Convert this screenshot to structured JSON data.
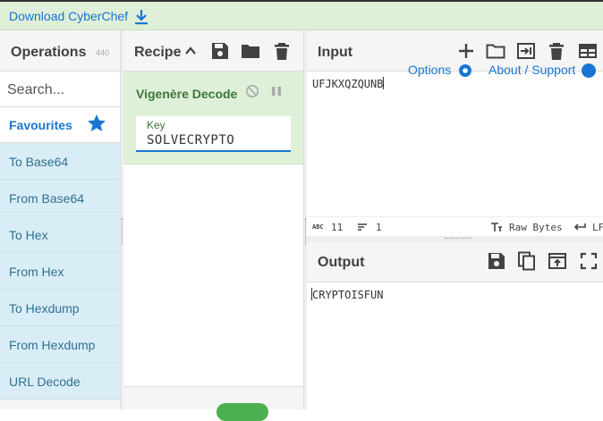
{
  "banner": {
    "download_label": "Download CyberChef",
    "download_icon": "download-icon"
  },
  "operations": {
    "title": "Operations",
    "count": "440",
    "search_placeholder": "Search...",
    "favourites_label": "Favourites",
    "items": [
      "To Base64",
      "From Base64",
      "To Hex",
      "From Hex",
      "To Hexdump",
      "From Hexdump",
      "URL Decode"
    ]
  },
  "recipe": {
    "title": "Recipe",
    "operation": {
      "name": "Vigenère Decode",
      "arg_label": "Key",
      "arg_value": "SOLVECRYPTO"
    }
  },
  "input": {
    "title": "Input",
    "overlay_options": "Options",
    "overlay_about": "About / Support",
    "text": "UFJKXQZQUNB",
    "status": {
      "length": "11",
      "lines": "1",
      "encoding": "Raw Bytes",
      "eol": "LF"
    }
  },
  "output": {
    "title": "Output",
    "text": "CRYPTOISFUN"
  },
  "colors": {
    "accent": "#1976d2",
    "recipe_green_bg": "#dff0d8",
    "recipe_green_text": "#3c763d",
    "operation_bg": "#d9edf7",
    "operation_text": "#31708f"
  }
}
